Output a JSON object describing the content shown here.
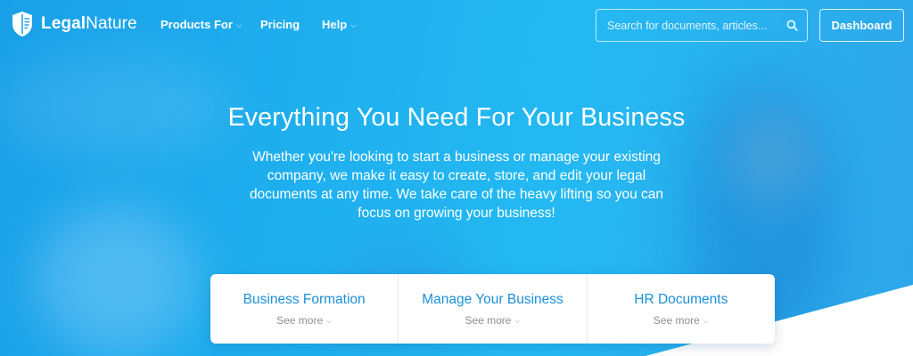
{
  "brand": {
    "name_bold": "Legal",
    "name_rest": "Nature"
  },
  "nav": {
    "items": [
      {
        "label": "Products For",
        "has_dropdown": true
      },
      {
        "label": "Pricing",
        "has_dropdown": false
      },
      {
        "label": "Help",
        "has_dropdown": true
      }
    ],
    "search": {
      "placeholder": "Search for documents, articles..."
    },
    "dashboard_label": "Dashboard",
    "chevron_glyph": "⌵"
  },
  "hero": {
    "title": "Everything You Need For Your Business",
    "subtitle": "Whether you're looking to start a business or manage your existing company, we make it easy to create, store, and edit your legal documents at any time. We take care of the heavy lifting so you can focus on growing your business!"
  },
  "cards": [
    {
      "title": "Business Formation",
      "more": "See more"
    },
    {
      "title": "Manage Your Business",
      "more": "See more"
    },
    {
      "title": "HR Documents",
      "more": "See more"
    }
  ],
  "colors": {
    "accent": "#1b8fd8",
    "hero_bg": "#1fb0ef",
    "muted": "#8a8f96"
  },
  "icons": {
    "logo": "shield-book-icon",
    "search": "search-icon",
    "dropdown": "chevron-down-icon"
  }
}
